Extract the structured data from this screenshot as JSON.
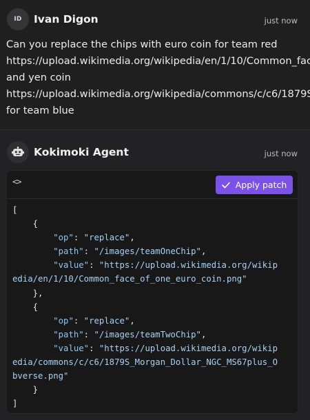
{
  "user_message": {
    "avatar_initials": "ID",
    "author": "Ivan Digon",
    "time": "just now",
    "lines": [
      "Can you replace the chips with euro coin for team red",
      "https://upload.wikimedia.org/wikipedia/en/1/10/Common_face_of_one_euro_coin.png",
      "and yen coin",
      "https://upload.wikimedia.org/wikipedia/commons/c/c6/1879S_Morgan_Dollar_NGC_MS67plus_Obverse.png",
      "for team blue"
    ]
  },
  "agent_message": {
    "avatar_icon": "robot-icon",
    "author": "Kokimoki Agent",
    "time": "just now",
    "code_toolbar": {
      "code_icon": "<>",
      "apply_label": "Apply patch"
    },
    "patch": [
      {
        "op_key": "\"op\"",
        "op_value": "\"replace\"",
        "path_key": "\"path\"",
        "path_value": "\"/images/teamOneChip\"",
        "value_key": "\"value\"",
        "value_line1": "\"https://upload.wikimedia.org/wikip",
        "value_line2": "edia/en/1/10/Common_face_of_one_euro_coin.png\""
      },
      {
        "op_key": "\"op\"",
        "op_value": "\"replace\"",
        "path_key": "\"path\"",
        "path_value": "\"/images/teamTwoChip\"",
        "value_key": "\"value\"",
        "value_line1": "\"https://upload.wikimedia.org/wikip",
        "value_line2": "edia/commons/c/c6/1879S_Morgan_Dollar_NGC_MS67plus_O",
        "value_line3": "bverse.png\""
      }
    ]
  },
  "colors": {
    "accent": "#7b52e8",
    "background": "#1f1f20",
    "code_background": "#181818",
    "json_key": "#8fc3f0"
  }
}
